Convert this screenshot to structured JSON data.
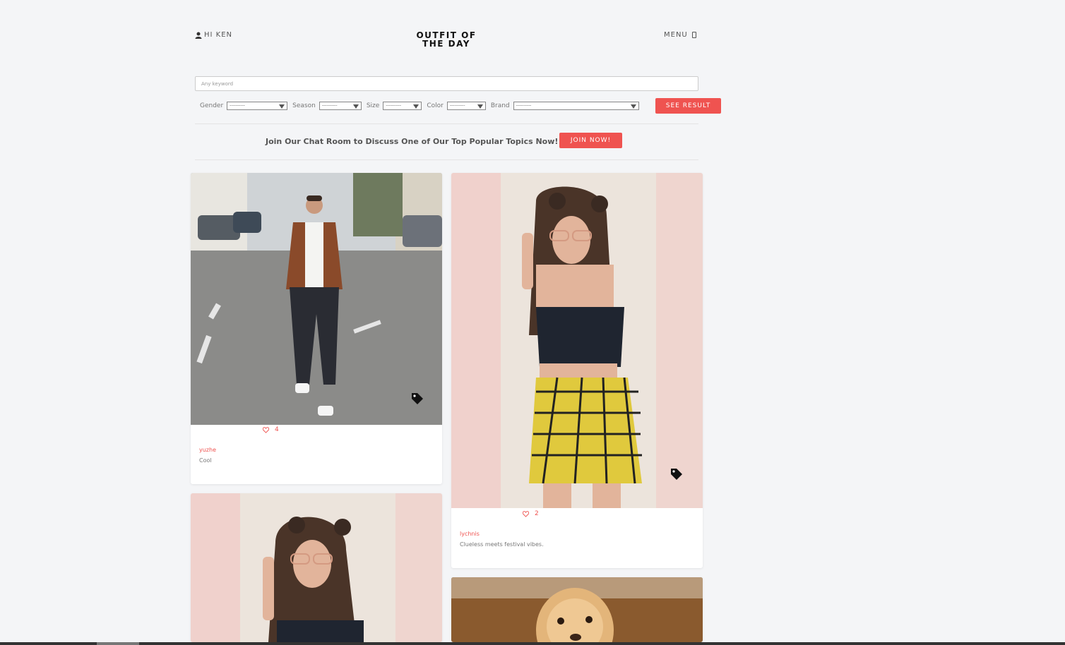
{
  "header": {
    "greeting": "HI KEN",
    "logo": "OUTFIT OF\nTHE DAY",
    "menu_label": "MENU"
  },
  "search": {
    "placeholder": "Any keyword"
  },
  "filters": {
    "gender": {
      "label": "Gender",
      "value": "----------"
    },
    "season": {
      "label": "Season",
      "value": "----------"
    },
    "size": {
      "label": "Size",
      "value": "----------"
    },
    "color": {
      "label": "Color",
      "value": "----------"
    },
    "brand": {
      "label": "Brand",
      "value": "----------"
    },
    "submit_label": "SEE RESULT"
  },
  "promo": {
    "text": "Join Our Chat Room to Discuss One of Our Top Popular Topics Now!",
    "button_label": "JOIN NOW!"
  },
  "posts": [
    {
      "likes": "4",
      "user": "yuzhe",
      "caption": "Cool"
    },
    {
      "likes": "2",
      "user": "lychnis",
      "caption": "Clueless meets festival vibes."
    }
  ],
  "colors": {
    "accent": "#ef5350",
    "background": "#f4f5f7"
  }
}
